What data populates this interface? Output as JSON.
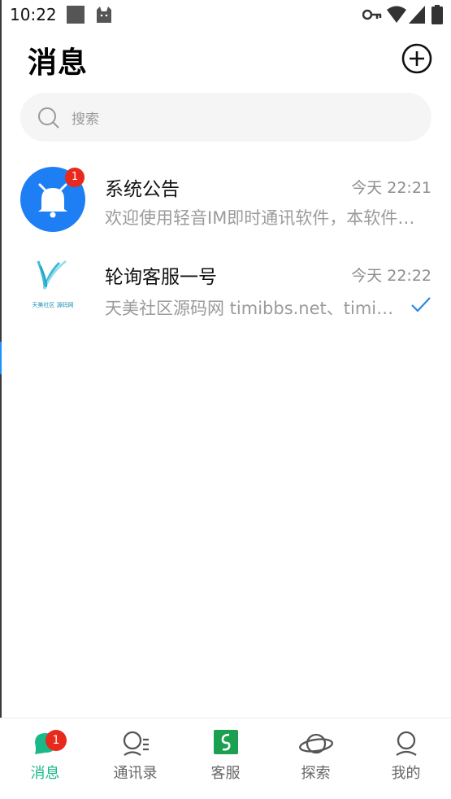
{
  "status_bar": {
    "time": "10:22"
  },
  "header": {
    "title": "消息"
  },
  "search": {
    "placeholder": "搜索"
  },
  "conversations": [
    {
      "name": "系统公告",
      "time": "今天 22:21",
      "preview": "欢迎使用轻音IM即时通讯软件，本软件仅供学习交流使用",
      "badge": "1"
    },
    {
      "name": "轮询客服一号",
      "time": "今天 22:22",
      "preview": "天美社区源码网 timibbs.net、timibbs.com",
      "avatar_text": "天美社区 源码网"
    }
  ],
  "tabbar": {
    "items": [
      {
        "label": "消息",
        "badge": "1"
      },
      {
        "label": "通讯录"
      },
      {
        "label": "客服"
      },
      {
        "label": "探索"
      },
      {
        "label": "我的"
      }
    ]
  },
  "colors": {
    "accent": "#19b98a",
    "badge": "#e8291c",
    "bell": "#1e7ff5",
    "check": "#2d86e8"
  }
}
